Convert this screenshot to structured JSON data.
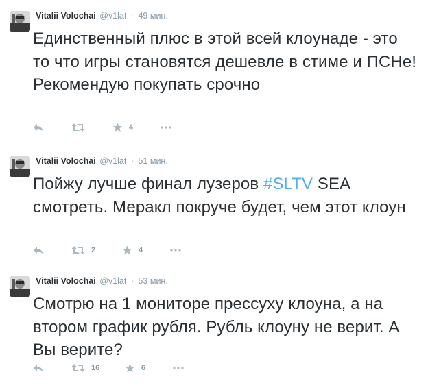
{
  "tweets": [
    {
      "fullname": "Vitalii Volochai",
      "username": "@v1lat",
      "separator": "·",
      "time": "49 мин.",
      "text": "Единственный плюс в этой всей клоунаде - это то что игры становятся дешевле в стиме и ПСНе! Рекомендую покупать срочно",
      "retweets": "",
      "favorites": "4"
    },
    {
      "fullname": "Vitalii Volochai",
      "username": "@v1lat",
      "separator": "·",
      "time": "51 мин.",
      "text_before": "Пойжу лучше финал лузеров ",
      "hashtag": "#SLTV",
      "text_after": " SEA смотреть. Меракл покруче будет, чем этот клоун",
      "retweets": "2",
      "favorites": "4"
    },
    {
      "fullname": "Vitalii Volochai",
      "username": "@v1lat",
      "separator": "·",
      "time": "53 мин.",
      "text": "Смотрю на 1 мониторе прессуху клоуна, а на втором график рубля. Рубль клоуну не верит. А Вы верите?",
      "retweets": "16",
      "favorites": "6"
    }
  ],
  "icons": {
    "reply": "reply-icon",
    "retweet": "retweet-icon",
    "favorite": "star-icon",
    "more": "more-icon"
  },
  "colors": {
    "text": "#292f33",
    "muted": "#8899a6",
    "icon": "#aab8c2",
    "hashtag": "#55acee",
    "divider": "#e1e8ed"
  }
}
